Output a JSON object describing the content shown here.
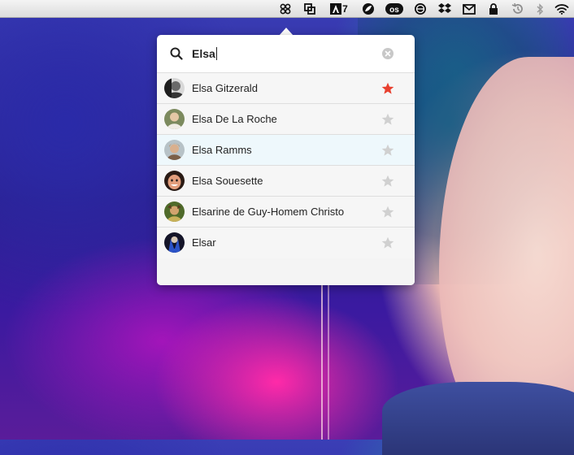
{
  "menubar": {
    "icons": [
      {
        "name": "clover-icon"
      },
      {
        "name": "window-arrange-icon"
      },
      {
        "name": "adobe-icon"
      },
      {
        "name": "fluid-icon"
      },
      {
        "name": "lastfm-icon"
      },
      {
        "name": "browser-icon"
      },
      {
        "name": "dropbox-icon"
      },
      {
        "name": "mail-icon"
      },
      {
        "name": "lock-icon"
      },
      {
        "name": "time-machine-icon"
      },
      {
        "name": "bluetooth-icon"
      },
      {
        "name": "wifi-icon"
      }
    ],
    "adobe_count": "7"
  },
  "search": {
    "query": "Elsa"
  },
  "results": [
    {
      "name": "Elsa Gitzerald",
      "favorite": true,
      "avatar_color": "#8a8a8a"
    },
    {
      "name": "Elsa De La Roche",
      "favorite": false,
      "avatar_color": "#9a9a70"
    },
    {
      "name": "Elsa Ramms",
      "favorite": false,
      "avatar_color": "#a88f72"
    },
    {
      "name": "Elsa Souesette",
      "favorite": false,
      "avatar_color": "#c67c62"
    },
    {
      "name": "Elsarine de Guy-Homem Christo",
      "favorite": false,
      "avatar_color": "#6d7a3c"
    },
    {
      "name": "Elsar",
      "favorite": false,
      "avatar_color": "#2c3a78"
    }
  ],
  "colors": {
    "star_active": "#e8402f",
    "star_inactive": "#d0d0d0",
    "selected_row": "#eef8fc"
  },
  "selected_index": 2
}
